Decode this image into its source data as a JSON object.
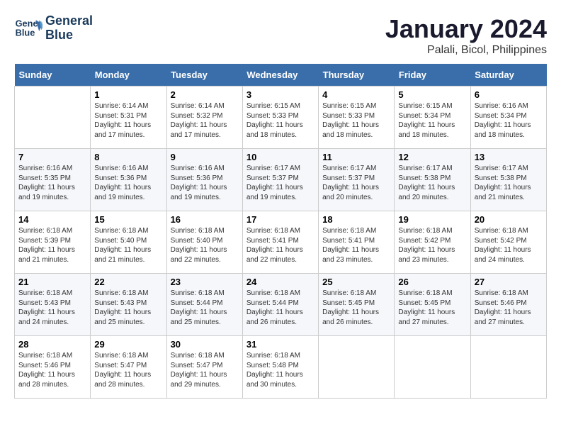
{
  "header": {
    "logo_line1": "General",
    "logo_line2": "Blue",
    "month": "January 2024",
    "location": "Palali, Bicol, Philippines"
  },
  "days_of_week": [
    "Sunday",
    "Monday",
    "Tuesday",
    "Wednesday",
    "Thursday",
    "Friday",
    "Saturday"
  ],
  "weeks": [
    [
      {
        "day": "",
        "empty": true
      },
      {
        "day": "1",
        "sunrise": "6:14 AM",
        "sunset": "5:31 PM",
        "daylight": "11 hours and 17 minutes."
      },
      {
        "day": "2",
        "sunrise": "6:14 AM",
        "sunset": "5:32 PM",
        "daylight": "11 hours and 17 minutes."
      },
      {
        "day": "3",
        "sunrise": "6:15 AM",
        "sunset": "5:33 PM",
        "daylight": "11 hours and 18 minutes."
      },
      {
        "day": "4",
        "sunrise": "6:15 AM",
        "sunset": "5:33 PM",
        "daylight": "11 hours and 18 minutes."
      },
      {
        "day": "5",
        "sunrise": "6:15 AM",
        "sunset": "5:34 PM",
        "daylight": "11 hours and 18 minutes."
      },
      {
        "day": "6",
        "sunrise": "6:16 AM",
        "sunset": "5:34 PM",
        "daylight": "11 hours and 18 minutes."
      }
    ],
    [
      {
        "day": "7",
        "sunrise": "6:16 AM",
        "sunset": "5:35 PM",
        "daylight": "11 hours and 19 minutes."
      },
      {
        "day": "8",
        "sunrise": "6:16 AM",
        "sunset": "5:36 PM",
        "daylight": "11 hours and 19 minutes."
      },
      {
        "day": "9",
        "sunrise": "6:16 AM",
        "sunset": "5:36 PM",
        "daylight": "11 hours and 19 minutes."
      },
      {
        "day": "10",
        "sunrise": "6:17 AM",
        "sunset": "5:37 PM",
        "daylight": "11 hours and 19 minutes."
      },
      {
        "day": "11",
        "sunrise": "6:17 AM",
        "sunset": "5:37 PM",
        "daylight": "11 hours and 20 minutes."
      },
      {
        "day": "12",
        "sunrise": "6:17 AM",
        "sunset": "5:38 PM",
        "daylight": "11 hours and 20 minutes."
      },
      {
        "day": "13",
        "sunrise": "6:17 AM",
        "sunset": "5:38 PM",
        "daylight": "11 hours and 21 minutes."
      }
    ],
    [
      {
        "day": "14",
        "sunrise": "6:18 AM",
        "sunset": "5:39 PM",
        "daylight": "11 hours and 21 minutes."
      },
      {
        "day": "15",
        "sunrise": "6:18 AM",
        "sunset": "5:40 PM",
        "daylight": "11 hours and 21 minutes."
      },
      {
        "day": "16",
        "sunrise": "6:18 AM",
        "sunset": "5:40 PM",
        "daylight": "11 hours and 22 minutes."
      },
      {
        "day": "17",
        "sunrise": "6:18 AM",
        "sunset": "5:41 PM",
        "daylight": "11 hours and 22 minutes."
      },
      {
        "day": "18",
        "sunrise": "6:18 AM",
        "sunset": "5:41 PM",
        "daylight": "11 hours and 23 minutes."
      },
      {
        "day": "19",
        "sunrise": "6:18 AM",
        "sunset": "5:42 PM",
        "daylight": "11 hours and 23 minutes."
      },
      {
        "day": "20",
        "sunrise": "6:18 AM",
        "sunset": "5:42 PM",
        "daylight": "11 hours and 24 minutes."
      }
    ],
    [
      {
        "day": "21",
        "sunrise": "6:18 AM",
        "sunset": "5:43 PM",
        "daylight": "11 hours and 24 minutes."
      },
      {
        "day": "22",
        "sunrise": "6:18 AM",
        "sunset": "5:43 PM",
        "daylight": "11 hours and 25 minutes."
      },
      {
        "day": "23",
        "sunrise": "6:18 AM",
        "sunset": "5:44 PM",
        "daylight": "11 hours and 25 minutes."
      },
      {
        "day": "24",
        "sunrise": "6:18 AM",
        "sunset": "5:44 PM",
        "daylight": "11 hours and 26 minutes."
      },
      {
        "day": "25",
        "sunrise": "6:18 AM",
        "sunset": "5:45 PM",
        "daylight": "11 hours and 26 minutes."
      },
      {
        "day": "26",
        "sunrise": "6:18 AM",
        "sunset": "5:45 PM",
        "daylight": "11 hours and 27 minutes."
      },
      {
        "day": "27",
        "sunrise": "6:18 AM",
        "sunset": "5:46 PM",
        "daylight": "11 hours and 27 minutes."
      }
    ],
    [
      {
        "day": "28",
        "sunrise": "6:18 AM",
        "sunset": "5:46 PM",
        "daylight": "11 hours and 28 minutes."
      },
      {
        "day": "29",
        "sunrise": "6:18 AM",
        "sunset": "5:47 PM",
        "daylight": "11 hours and 28 minutes."
      },
      {
        "day": "30",
        "sunrise": "6:18 AM",
        "sunset": "5:47 PM",
        "daylight": "11 hours and 29 minutes."
      },
      {
        "day": "31",
        "sunrise": "6:18 AM",
        "sunset": "5:48 PM",
        "daylight": "11 hours and 30 minutes."
      },
      {
        "day": "",
        "empty": true
      },
      {
        "day": "",
        "empty": true
      },
      {
        "day": "",
        "empty": true
      }
    ]
  ]
}
